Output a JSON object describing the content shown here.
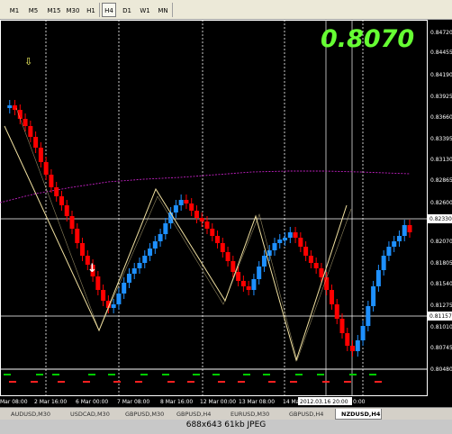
{
  "toolbar": {
    "timeframes": [
      {
        "label": "M1",
        "active": false
      },
      {
        "label": "M5",
        "active": false
      },
      {
        "label": "M15",
        "active": false
      },
      {
        "label": "M30",
        "active": false
      },
      {
        "label": "H1",
        "active": false
      },
      {
        "label": "H4",
        "active": true
      },
      {
        "label": "D1",
        "active": false
      },
      {
        "label": "W1",
        "active": false
      },
      {
        "label": "MN",
        "active": false
      }
    ]
  },
  "chart": {
    "big_price": "0.8070",
    "price_axis": [
      "0.84720",
      "0.84455",
      "0.84190",
      "0.83925",
      "0.83660",
      "0.83395",
      "0.83130",
      "0.82865",
      "0.82600",
      "0.82330",
      "0.82070",
      "0.81805",
      "0.81540",
      "0.81275",
      "0.81157",
      "0.81010",
      "0.80745",
      "0.80480"
    ],
    "current_price_label": "0.82330",
    "support_price_label": "0.81157",
    "time_axis": [
      "Mar 08:00",
      "2 Mar 16:00",
      "6 Mar 00:00",
      "7 Mar 08:00",
      "8 Mar 16:00",
      "12 Mar 00:00",
      "13 Mar 08:00",
      "14 Mar 16:00",
      "2012.03.16 20:00",
      "0:00"
    ],
    "colors": {
      "bull": "#1e90ff",
      "bear": "#ff0000",
      "zigzag": "#f0e0a0",
      "ma": "#c020c0",
      "hline": "#ffffff",
      "bigprice": "#66ff33",
      "arrow_up": "#ffffff",
      "arrow_down": "#ffff66"
    }
  },
  "symbol_tabs": [
    {
      "label": "AUDUSD,M30",
      "active": false
    },
    {
      "label": "USDCAD,M30",
      "active": false
    },
    {
      "label": "GBPUSD,M30",
      "active": false
    },
    {
      "label": "GBPUSD,H4",
      "active": false
    },
    {
      "label": "EURUSD,M30",
      "active": false
    },
    {
      "label": "GBPUSD,H4",
      "active": false
    },
    {
      "label": "NZDUSD,H4",
      "active": true
    }
  ],
  "footer": {
    "text": "688x643  61kb  JPEG"
  }
}
